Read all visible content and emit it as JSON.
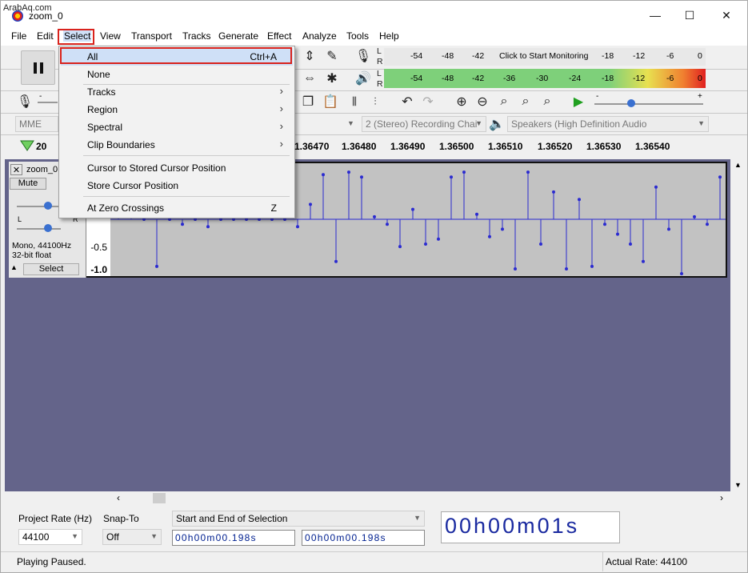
{
  "watermark": "ArabAq.com",
  "window": {
    "title": "zoom_0",
    "controls": [
      "—",
      "☐",
      "✕"
    ]
  },
  "menubar": [
    "File",
    "Edit",
    "Select",
    "View",
    "Transport",
    "Tracks",
    "Generate",
    "Effect",
    "Analyze",
    "Tools",
    "Help"
  ],
  "meters": {
    "record_scale": [
      "-54",
      "-48",
      "-42",
      "Click to Start Monitoring",
      "-18",
      "-12",
      "-6",
      "0"
    ],
    "playback_scale": [
      "-54",
      "-48",
      "-42",
      "-36",
      "-30",
      "-24",
      "-18",
      "-12",
      "-6",
      "0"
    ],
    "channel_labels": {
      "left": "L",
      "right": "R"
    }
  },
  "device_toolbar": {
    "host": "MME",
    "recording_channels": "2 (Stereo) Recording Chai",
    "playback_device": "Speakers (High Definition Audio"
  },
  "ruler": {
    "start_label": "20",
    "ticks": [
      "1.36470",
      "1.36480",
      "1.36490",
      "1.36500",
      "1.36510",
      "1.36520",
      "1.36530",
      "1.36540"
    ]
  },
  "track": {
    "name": "zoom_0",
    "mute": "Mute",
    "pan_labels": {
      "left": "L",
      "right": "R"
    },
    "info_line1": "Mono, 44100Hz",
    "info_line2": "32-bit float",
    "select_label": "Select",
    "scale": [
      "-0.5",
      "-1.0"
    ],
    "samples": [
      0.65,
      0.6,
      0.0,
      -0.95,
      0.0,
      -0.1,
      0.0,
      -0.15,
      0.0,
      0.0,
      0.0,
      0.0,
      0.0,
      0.0,
      -0.15,
      0.3,
      0.9,
      -0.85,
      0.95,
      0.85,
      0.05,
      -0.1,
      -0.55,
      0.2,
      -0.5,
      -0.4,
      0.85,
      0.95,
      0.1,
      -0.35,
      -0.2,
      -1.0,
      0.95,
      -0.5,
      0.55,
      -1.0,
      0.4,
      -0.95,
      -0.1,
      -0.3,
      -0.5,
      -0.85,
      0.65,
      -0.2,
      -1.15,
      0.05,
      -0.1,
      0.85,
      -0.95,
      0.95,
      -1.1,
      0.95,
      0.75
    ]
  },
  "select_menu": {
    "items": [
      {
        "label": "All",
        "shortcut": "Ctrl+A",
        "submenu": false
      },
      {
        "label": "None",
        "shortcut": "",
        "submenu": false
      },
      {
        "label": "Tracks",
        "shortcut": "",
        "submenu": true
      },
      {
        "label": "Region",
        "shortcut": "",
        "submenu": true
      },
      {
        "label": "Spectral",
        "shortcut": "",
        "submenu": true
      },
      {
        "label": "Clip Boundaries",
        "shortcut": "",
        "submenu": true
      },
      {
        "label": "Cursor to Stored Cursor Position",
        "shortcut": "",
        "submenu": false
      },
      {
        "label": "Store Cursor Position",
        "shortcut": "",
        "submenu": false
      },
      {
        "label": "At Zero Crossings",
        "shortcut": "Z",
        "submenu": false
      }
    ]
  },
  "selection_toolbar": {
    "project_rate_label": "Project Rate (Hz)",
    "project_rate_value": "44100",
    "snap_to_label": "Snap-To",
    "snap_to_value": "Off",
    "selection_mode": "Start and End of Selection",
    "start_time": "00h00m00.198s",
    "end_time": "00h00m00.198s"
  },
  "time_display": "00h00m01s",
  "status": {
    "left": "Playing Paused.",
    "right": "Actual Rate: 44100"
  },
  "colors": {
    "accent_red": "#d9231d",
    "wave": "#2b2bd0",
    "canvas_bg": "#64648a"
  }
}
